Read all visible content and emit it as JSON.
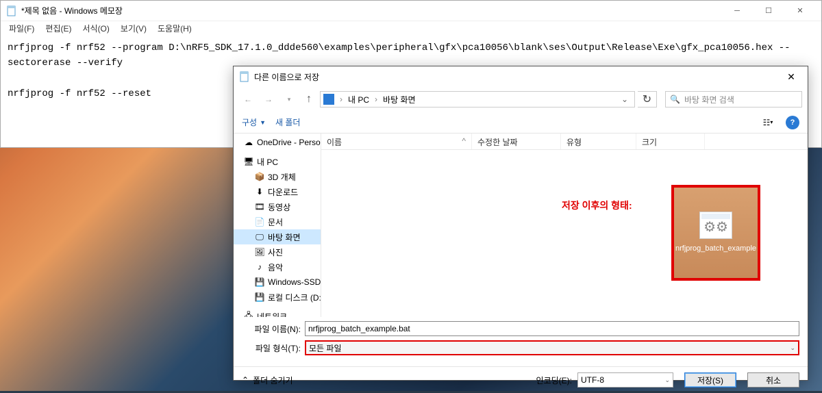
{
  "notepad": {
    "title": "*제목 없음 - Windows 메모장",
    "menu": {
      "file": "파일(F)",
      "edit": "편집(E)",
      "format": "서식(O)",
      "view": "보기(V)",
      "help": "도움말(H)"
    },
    "content": "nrfjprog -f nrf52 --program D:\\nRF5_SDK_17.1.0_ddde560\\examples\\peripheral\\gfx\\pca10056\\blank\\ses\\Output\\Release\\Exe\\gfx_pca10056.hex --sectorerase --verify\n\nnrfjprog -f nrf52 --reset"
  },
  "dialog": {
    "title": "다른 이름으로 저장",
    "breadcrumb": {
      "pc": "내 PC",
      "loc": "바탕 화면"
    },
    "search_placeholder": "바탕 화면 검색",
    "toolbar": {
      "organize": "구성",
      "newfolder": "새 폴더"
    },
    "headers": {
      "name": "이름",
      "date": "수정한 날짜",
      "type": "유형",
      "size": "크기"
    },
    "sidebar": {
      "onedrive": "OneDrive - Person",
      "thispc": "내 PC",
      "items": [
        "3D 개체",
        "다운로드",
        "동영상",
        "문서",
        "바탕 화면",
        "사진",
        "음악",
        "Windows-SSD (",
        "로컬 디스크 (D:)"
      ],
      "network": "네트워크"
    },
    "filename_label": "파일 이름(N):",
    "filename_value": "nrfjprog_batch_example.bat",
    "filetype_label": "파일 형식(T):",
    "filetype_value": "모든 파일",
    "hide_folders": "폴더 숨기기",
    "encoding_label": "인코딩(E):",
    "encoding_value": "UTF-8",
    "save_btn": "저장(S)",
    "cancel_btn": "취소"
  },
  "annotation": {
    "label": "저장 이후의 형태:",
    "filename": "nrfjprog_batch_example"
  }
}
